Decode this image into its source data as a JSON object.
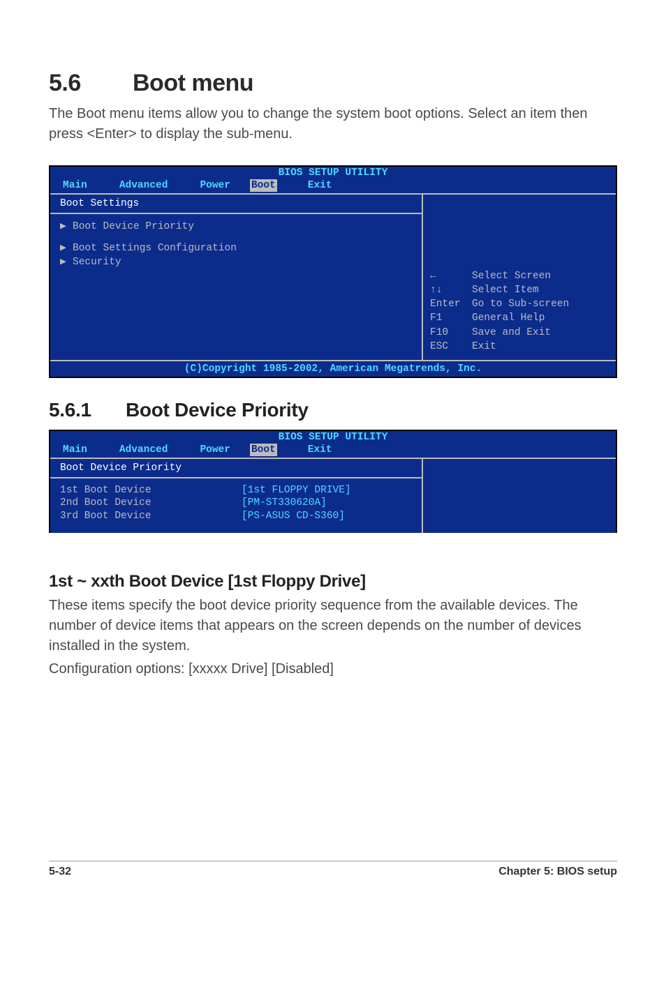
{
  "section": {
    "number": "5.6",
    "title": "Boot menu",
    "intro": "The Boot menu items allow you to change the system boot options. Select an item then press <Enter> to display the sub-menu."
  },
  "bios1": {
    "title": "BIOS SETUP UTILITY",
    "tabs": [
      "Main",
      "Advanced",
      "Power",
      "Boot",
      "Exit"
    ],
    "active_tab": "Boot",
    "heading": "Boot Settings",
    "items": [
      "Boot Device Priority",
      "Boot Settings Configuration",
      "Security"
    ],
    "help": [
      {
        "key": "←",
        "label": "Select Screen"
      },
      {
        "key": "↑↓",
        "label": "Select Item"
      },
      {
        "key": "Enter",
        "label": "Go to Sub-screen"
      },
      {
        "key": "F1",
        "label": "General Help"
      },
      {
        "key": "F10",
        "label": "Save and Exit"
      },
      {
        "key": "ESC",
        "label": "Exit"
      }
    ],
    "footer": "(C)Copyright 1985-2002, American Megatrends, Inc."
  },
  "sub1": {
    "number": "5.6.1",
    "title": "Boot Device Priority"
  },
  "bios2": {
    "title": "BIOS SETUP UTILITY",
    "tabs": [
      "Main",
      "Advanced",
      "Power",
      "Boot",
      "Exit"
    ],
    "active_tab": "Boot",
    "heading": "Boot Device Priority",
    "rows": [
      {
        "k": "1st Boot Device",
        "v": "[1st FLOPPY DRIVE]"
      },
      {
        "k": "2nd Boot Device",
        "v": "[PM-ST330620A]"
      },
      {
        "k": "3rd Boot Device",
        "v": "[PS-ASUS CD-S360]"
      }
    ]
  },
  "sub2": {
    "title": "1st ~ xxth Boot Device [1st Floppy Drive]",
    "body1": "These items specify the boot device priority sequence from the available devices. The number of device items that appears on the screen depends on the number of devices installed in the system.",
    "body2": "Configuration options: [xxxxx Drive] [Disabled]"
  },
  "footer": {
    "left": "5-32",
    "right": "Chapter 5: BIOS setup"
  }
}
